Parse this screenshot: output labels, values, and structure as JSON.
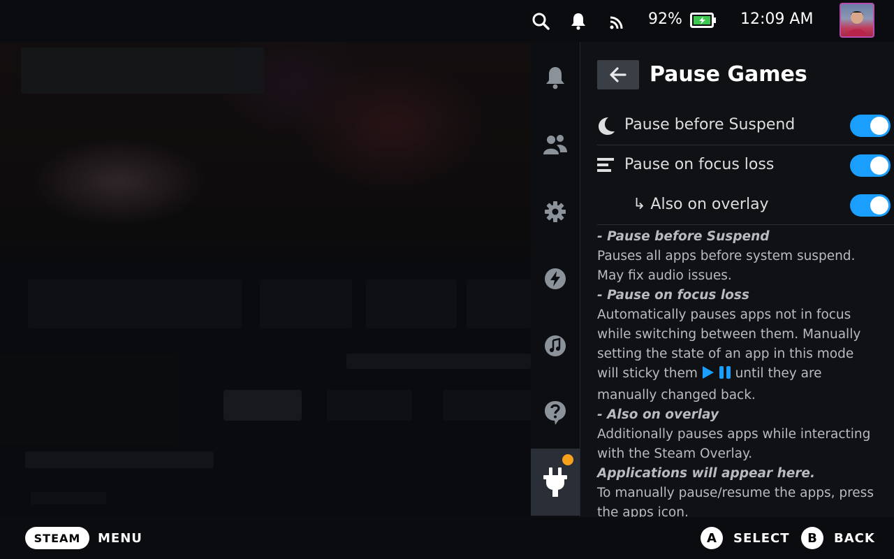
{
  "topbar": {
    "battery_percent": "92%",
    "time": "12:09 AM",
    "icons": [
      "search-icon",
      "bell-icon",
      "wifi-icon",
      "battery-charging-icon"
    ]
  },
  "rail": {
    "items": [
      "bell-icon",
      "friends-icon",
      "gear-icon",
      "lightning-icon",
      "music-icon",
      "help-icon",
      "plug-icon"
    ],
    "active": "plug-icon",
    "notification_dot_color": "#f7a21a"
  },
  "panel": {
    "title": "Pause Games",
    "toggles": [
      {
        "label": "Pause before Suspend",
        "icon": "moon-icon",
        "on": true
      },
      {
        "label": "Pause on focus loss",
        "icon": "align-left-icon",
        "on": true
      },
      {
        "label": "↳ Also on overlay",
        "icon": "",
        "on": true
      }
    ],
    "description": {
      "h1": "- Pause before Suspend",
      "p1": "Pauses all apps before system suspend. May fix audio issues.",
      "h2": "- Pause on focus loss",
      "p2a": "Automatically pauses apps not in focus while switching between them. Manually setting the state of an app in this mode will sticky them",
      "p2b": "until they are manually changed back.",
      "h3": "- Also on overlay",
      "p3": "Additionally pauses apps while interacting with the Steam Overlay.",
      "h4": "Applications will appear here.",
      "p4": "To manually pause/resume the apps, press the apps icon."
    }
  },
  "bottombar": {
    "steam_label": "STEAM",
    "menu_label": "MENU",
    "a_glyph": "A",
    "select_label": "SELECT",
    "b_glyph": "B",
    "back_label": "BACK"
  },
  "colors": {
    "accent": "#1a9fff",
    "background": "#0f1115",
    "rail_active": "#2a2e36"
  }
}
